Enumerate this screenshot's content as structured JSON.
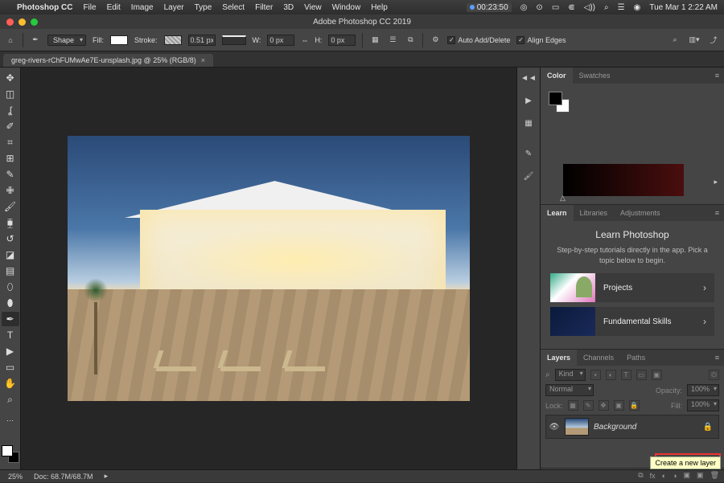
{
  "mac_menu": {
    "app": "Photoshop CC",
    "items": [
      "File",
      "Edit",
      "Image",
      "Layer",
      "Type",
      "Select",
      "Filter",
      "3D",
      "View",
      "Window",
      "Help"
    ],
    "timer": "00:23:50",
    "datetime": "Tue Mar 1  2:22 AM"
  },
  "titlebar": {
    "title": "Adobe Photoshop CC 2019"
  },
  "options": {
    "shape_label": "Shape",
    "fill_label": "Fill:",
    "stroke_label": "Stroke:",
    "stroke_value": "0.51 px",
    "w_label": "W:",
    "w_value": "0 px",
    "h_label": "H:",
    "h_value": "0 px",
    "auto_add": "Auto Add/Delete",
    "align_edges": "Align Edges"
  },
  "document_tab": {
    "label": "greg-rivers-rChFUMwAe7E-unsplash.jpg @ 25% (RGB/8)"
  },
  "panels": {
    "color": {
      "tabs": [
        "Color",
        "Swatches"
      ]
    },
    "learn": {
      "tabs": [
        "Learn",
        "Libraries",
        "Adjustments"
      ],
      "heading": "Learn Photoshop",
      "blurb": "Step-by-step tutorials directly in the app. Pick a topic below to begin.",
      "cards": [
        "Projects",
        "Fundamental Skills"
      ]
    },
    "layers": {
      "tabs": [
        "Layers",
        "Channels",
        "Paths"
      ],
      "kind_placeholder": "Kind",
      "blend_mode": "Normal",
      "opacity_label": "Opacity:",
      "opacity_value": "100%",
      "lock_label": "Lock:",
      "fill_label": "Fill:",
      "fill_value": "100%",
      "layer_name": "Background",
      "footer_fx": "fx",
      "tooltip": "Create a new layer"
    }
  },
  "status": {
    "zoom": "25%",
    "doc": "Doc: 68.7M/68.7M"
  }
}
